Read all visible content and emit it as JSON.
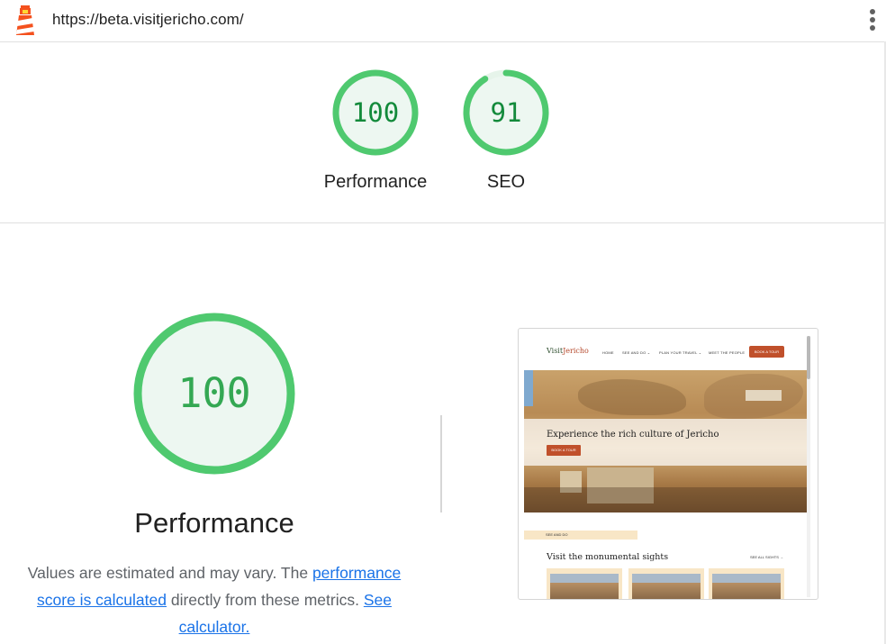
{
  "topbar": {
    "url": "https://beta.visitjericho.com/",
    "logo_icon": "lighthouse-icon",
    "menu_icon": "more-vert-icon"
  },
  "summary_gauges": [
    {
      "score": "100",
      "label": "Performance",
      "fraction": 1.0
    },
    {
      "score": "91",
      "label": "SEO",
      "fraction": 0.91
    }
  ],
  "performance": {
    "score": "100",
    "title": "Performance",
    "desc_prefix": "Values are estimated and may vary. The ",
    "link_score": "performance score is calculated",
    "desc_mid": " directly from these metrics. ",
    "link_calculator": "See calculator."
  },
  "colors": {
    "pass": "#0cce6b",
    "pass_fill": "#edf7f1",
    "link": "#1a73e8",
    "accent": "#c0502b"
  },
  "thumbnail": {
    "logo_text_a": "Visit",
    "logo_text_b": "Jericho",
    "nav": [
      "HOME",
      "SEE AND DO ⌄",
      "PLAN YOUR TRAVEL ⌄",
      "MEET THE PEOPLE"
    ],
    "nav_button": "BOOK A TOUR",
    "hero_title": "Experience the rich culture of Jericho",
    "hero_button": "BOOK A TOUR",
    "tag": "SEE AND DO",
    "section_title": "Visit the monumental sights",
    "see_all": "SEE ALL SIGHTS →"
  }
}
